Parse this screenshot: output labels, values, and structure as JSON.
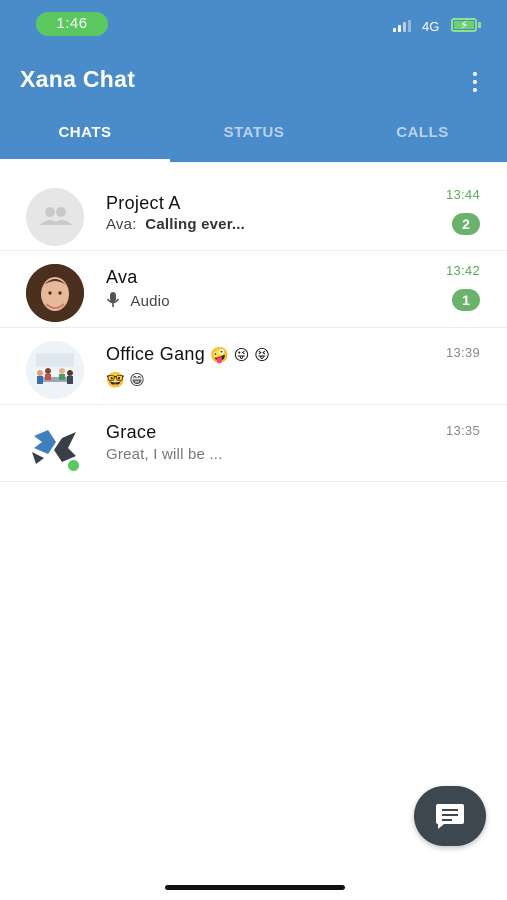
{
  "status_bar": {
    "time": "1:46",
    "network": "4G"
  },
  "app_bar": {
    "title": "Xana Chat",
    "menu_icon": "more-vertical-icon",
    "color": "#4a8bc9"
  },
  "tabs": [
    {
      "label": "CHATS",
      "active": true
    },
    {
      "label": "STATUS",
      "active": false
    },
    {
      "label": "CALLS",
      "active": false
    }
  ],
  "chats": [
    {
      "name": "Project A",
      "sender": "Ava:",
      "preview": "Calling ever...",
      "time": "13:44",
      "unread_count": "2",
      "avatar_icon": "group-icon"
    },
    {
      "name": "Ava",
      "preview": "Audio",
      "preview_icon": "microphone-icon",
      "time": "13:42",
      "unread_count": "1",
      "avatar_icon": "person-photo"
    },
    {
      "name": "Office Gang",
      "name_emojis": "🤪 😜 😝",
      "preview": "🤓 😁",
      "time": "13:39",
      "avatar_icon": "office-illustration"
    },
    {
      "name": "Grace",
      "preview": "Great, I will be ...",
      "time": "13:35",
      "avatar_icon": "logo-online-status",
      "online": true
    }
  ],
  "fab": {
    "icon": "new-chat-icon"
  },
  "colors": {
    "accent": "#4a8bc9",
    "unread_green": "#6bb36b",
    "status_pill": "#5ac85f",
    "fab": "#3c4750"
  }
}
